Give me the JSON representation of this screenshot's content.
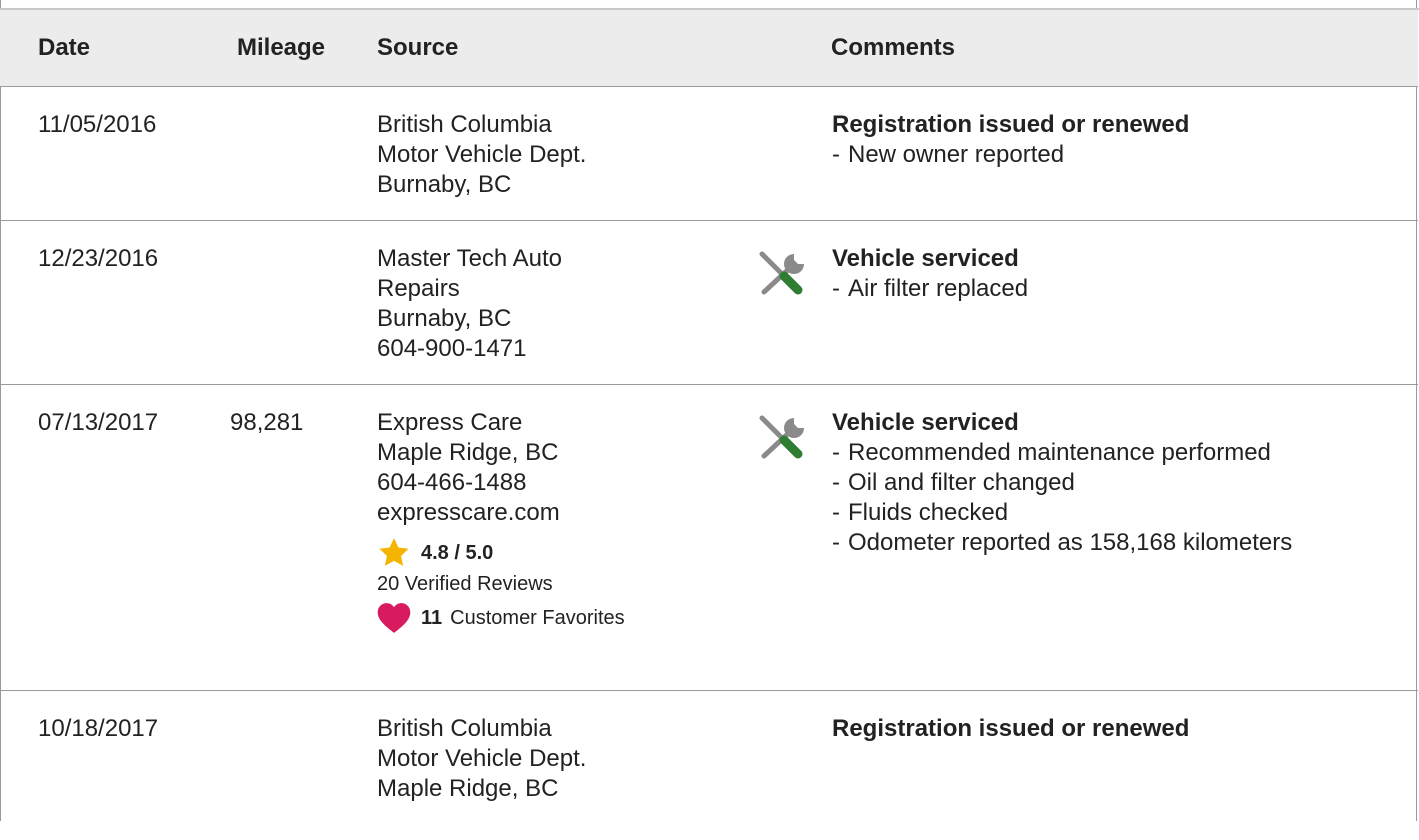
{
  "table": {
    "headers": {
      "date": "Date",
      "mileage": "Mileage",
      "source": "Source",
      "comments": "Comments"
    },
    "rows": [
      {
        "date": "11/05/2016",
        "mileage": "",
        "source": [
          "British Columbia",
          "Motor Vehicle Dept.",
          "Burnaby, BC"
        ],
        "icon": "",
        "title": "Registration issued or renewed",
        "details": [
          "New owner reported"
        ]
      },
      {
        "date": "12/23/2016",
        "mileage": "",
        "source": [
          "Master Tech Auto",
          "Repairs",
          "Burnaby, BC",
          "604-900-1471"
        ],
        "icon": "service-tools-icon",
        "title": "Vehicle serviced",
        "details": [
          "Air filter replaced"
        ]
      },
      {
        "date": "07/13/2017",
        "mileage": "98,281",
        "source": [
          "Express Care",
          "Maple Ridge, BC",
          "604-466-1488",
          "expresscare.com"
        ],
        "rating": "4.8 / 5.0",
        "reviews": "20 Verified Reviews",
        "favorites_count": "11",
        "favorites_label": "Customer Favorites",
        "icon": "service-tools-icon",
        "title": "Vehicle serviced",
        "details": [
          "Recommended maintenance performed",
          "Oil and filter changed",
          "Fluids checked",
          "Odometer reported as 158,168 kilometers"
        ]
      },
      {
        "date": "10/18/2017",
        "mileage": "",
        "source": [
          "British Columbia",
          "Motor Vehicle Dept.",
          "Maple Ridge, BC"
        ],
        "icon": "",
        "title": "Registration issued or renewed",
        "details": []
      }
    ]
  },
  "dash": "-",
  "colors": {
    "header_bg": "#ececec",
    "border": "#9a9a9a",
    "star": "#f5b400",
    "heart": "#d81b60",
    "wrench_green": "#2e7d32",
    "tool_gray": "#8a8a8a"
  }
}
